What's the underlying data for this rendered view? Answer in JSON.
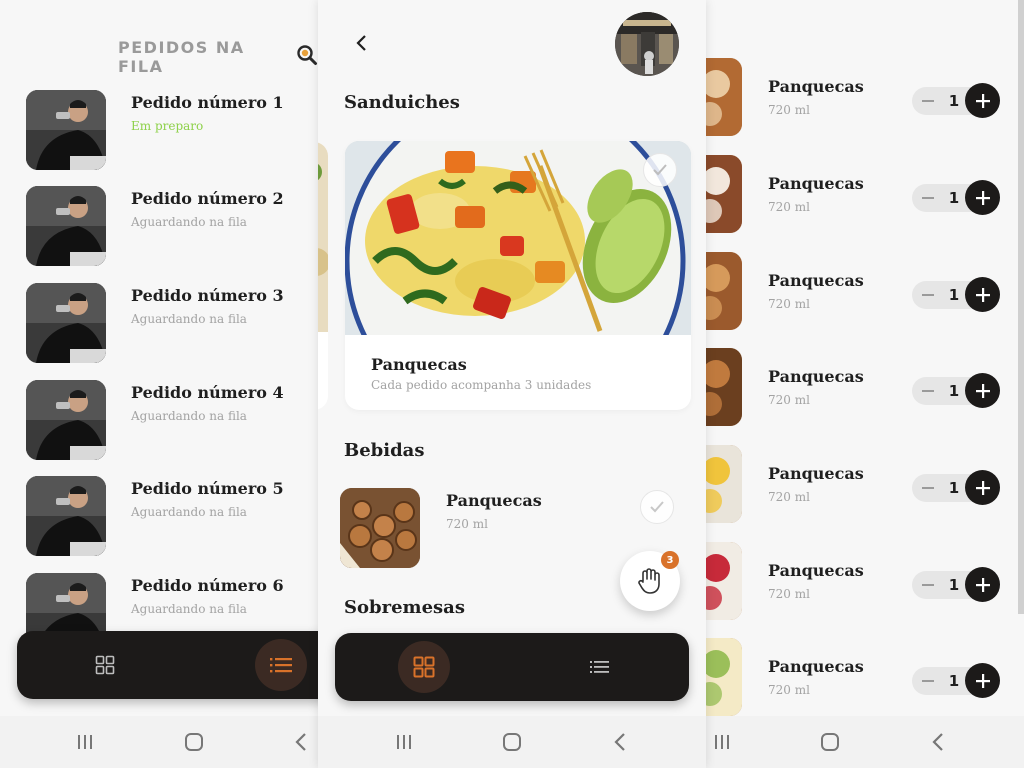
{
  "colors": {
    "accent": "#d9722a",
    "status_preparing": "#8ed14a",
    "dark_bar": "#1c1a19",
    "muted_text": "#a3a3a3"
  },
  "left": {
    "header_title": "PEDIDOS NA FILA",
    "header_icon": "search-icon",
    "orders": [
      {
        "title": "Pedido número 1",
        "status": "Em preparo",
        "status_type": "preparing"
      },
      {
        "title": "Pedido número 2",
        "status": "Aguardando na fila",
        "status_type": "waiting"
      },
      {
        "title": "Pedido número 3",
        "status": "Aguardando na fila",
        "status_type": "waiting"
      },
      {
        "title": "Pedido número 4",
        "status": "Aguardando na fila",
        "status_type": "waiting"
      },
      {
        "title": "Pedido número 5",
        "status": "Aguardando na fila",
        "status_type": "waiting"
      },
      {
        "title": "Pedido número 6",
        "status": "Aguardando na fila",
        "status_type": "waiting"
      }
    ],
    "bottom_nav": [
      {
        "icon": "grid-icon",
        "active": false
      },
      {
        "icon": "list-icon",
        "active": true
      }
    ]
  },
  "center": {
    "sections": {
      "sandwiches": "Sanduiches",
      "drinks": "Bebidas",
      "desserts": "Sobremesas"
    },
    "featured_card": {
      "title": "Panquecas",
      "subtitle": "Cada pedido acompanha 3 unidades"
    },
    "drink_item": {
      "name": "Panquecas",
      "size": "720 ml"
    },
    "fab": {
      "icon": "hand-icon",
      "badge": "3"
    },
    "bottom_nav": [
      {
        "icon": "grid-icon",
        "active": true
      },
      {
        "icon": "list-icon",
        "active": false
      }
    ]
  },
  "right": {
    "items": [
      {
        "name": "Panquecas",
        "size": "720 ml",
        "qty": "1"
      },
      {
        "name": "Panquecas",
        "size": "720 ml",
        "qty": "1"
      },
      {
        "name": "Panquecas",
        "size": "720 ml",
        "qty": "1"
      },
      {
        "name": "Panquecas",
        "size": "720 ml",
        "qty": "1"
      },
      {
        "name": "Panquecas",
        "size": "720 ml",
        "qty": "1"
      },
      {
        "name": "Panquecas",
        "size": "720 ml",
        "qty": "1"
      },
      {
        "name": "Panquecas",
        "size": "720 ml",
        "qty": "1"
      }
    ]
  },
  "system_nav": {
    "recents_icon": "recents-icon",
    "home_icon": "home-icon",
    "back_icon": "back-icon"
  }
}
